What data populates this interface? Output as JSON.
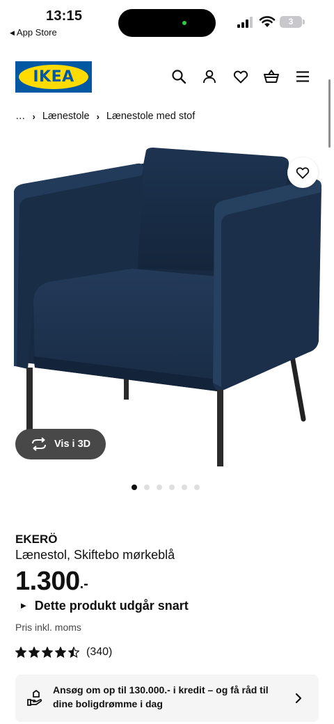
{
  "status_bar": {
    "time": "13:15",
    "back_app": "App Store",
    "battery": "3"
  },
  "header": {
    "logo_text": "IKEA",
    "brand_colors": {
      "blue": "#0058a3",
      "yellow": "#ffdb00"
    },
    "icons": [
      "search-icon",
      "account-icon",
      "heart-icon",
      "basket-icon",
      "menu-icon"
    ]
  },
  "breadcrumb": {
    "items": [
      "…",
      "Lænestole",
      "Lænestole med stof"
    ]
  },
  "gallery": {
    "view_3d_label": "Vis i 3D",
    "dot_count": 6,
    "active_dot": 0
  },
  "product": {
    "name": "EKERÖ",
    "description": "Lænestol, Skiftebo mørkeblå",
    "price_main": "1.300",
    "price_suffix": ".-",
    "notice": "Dette produkt udgår snart",
    "vat_note": "Pris inkl. moms",
    "rating": 4.5,
    "review_count": "(340)"
  },
  "credit_banner": {
    "text": "Ansøg om op til 130.000.- i kredit – og få råd til dine boligdrømme i dag"
  }
}
